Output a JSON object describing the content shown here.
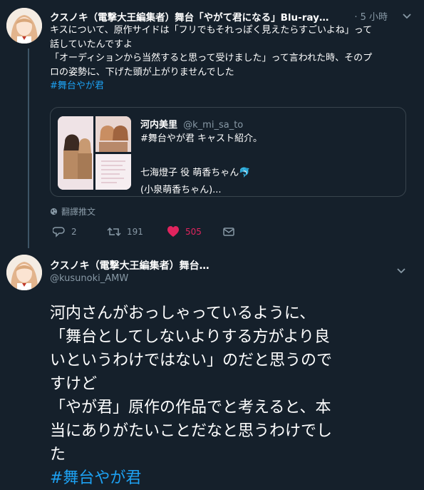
{
  "tweet1": {
    "author_name": "クスノキ（電撃大王編集者）舞台「やがて君になる」Blu-ray…",
    "timestamp": "· 5 小時",
    "text_lines": [
      "キスについて、原作サイドは「フリでもそれっぽく見えたらすごいよね」って",
      "話していたんですよ",
      "「オーディションから当然すると思って受けました」って言われた時、そのプ",
      "ロの姿勢に、下げた頭が上がりませんでした"
    ],
    "hashtag": "#舞台やが君",
    "quoted": {
      "author_name": "河内美里",
      "handle": "@k_mi_sa_to",
      "text_lines": [
        "#舞台やが君 キャスト紹介。",
        "",
        "七海燈子 役  萌香ちゃん🐬",
        "(小泉萌香ちゃん)..."
      ]
    },
    "translate_label": "翻譯推文",
    "actions": {
      "reply_count": "2",
      "retweet_count": "191",
      "like_count": "505"
    }
  },
  "tweet2": {
    "author_name": "クスノキ（電撃大王編集者）舞台…",
    "handle": "@kusunoki_AMW",
    "text_lines": [
      "河内さんがおっしゃっているように、",
      "「舞台としてしないよりする方がより良",
      "いというわけではない」のだと思うので",
      "すけど",
      "「やが君」原作の作品でと考えると、本",
      "当にありがたいことだなと思うわけでし",
      "た"
    ],
    "hashtag": "#舞台やが君"
  },
  "colors": {
    "background": "#15202b",
    "accent": "#1da1f2",
    "like": "#e0245e",
    "muted": "#8899a6",
    "border": "#38444d"
  }
}
